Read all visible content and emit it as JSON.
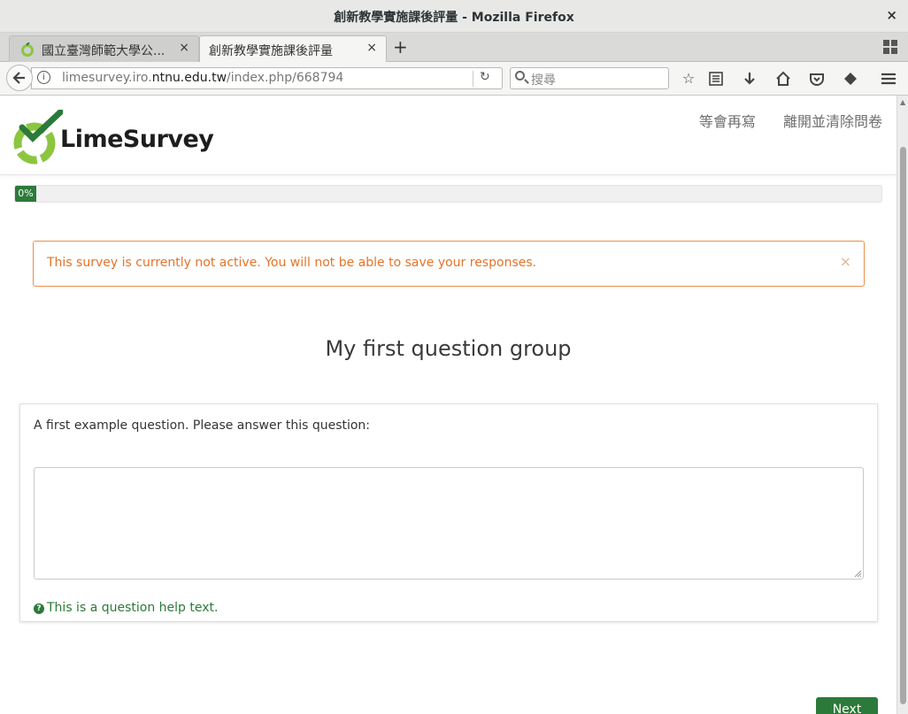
{
  "window": {
    "title": "創新教學實施課後評量 - Mozilla Firefox",
    "close_glyph": "×"
  },
  "tabs": [
    {
      "label": "國立臺灣師範大學公...",
      "active": false
    },
    {
      "label": "創新教學實施課後評量",
      "active": true
    }
  ],
  "tab_close_glyph": "×",
  "new_tab_glyph": "+",
  "navbar": {
    "url_prefix": "limesurvey.iro.",
    "url_domain": "ntnu.edu.tw",
    "url_path": "/index.php/668794",
    "search_placeholder": "搜尋"
  },
  "site": {
    "logo_text": "LimeSurvey",
    "links": [
      "等會再寫",
      "離開並清除問卷"
    ]
  },
  "progress": {
    "percent": 0,
    "label": "0%"
  },
  "alert": {
    "message": "This survey is currently not active. You will not be able to save your responses.",
    "close_glyph": "×"
  },
  "group_title": "My first question group",
  "question": {
    "text": "A first example question. Please answer this question:",
    "answer_value": "",
    "help_text": "This is a question help text."
  },
  "next_button_label": "Next",
  "colors": {
    "brand_green": "#2c7a3a",
    "alert_orange": "#e67328",
    "logo_lime": "#8cc63f"
  }
}
